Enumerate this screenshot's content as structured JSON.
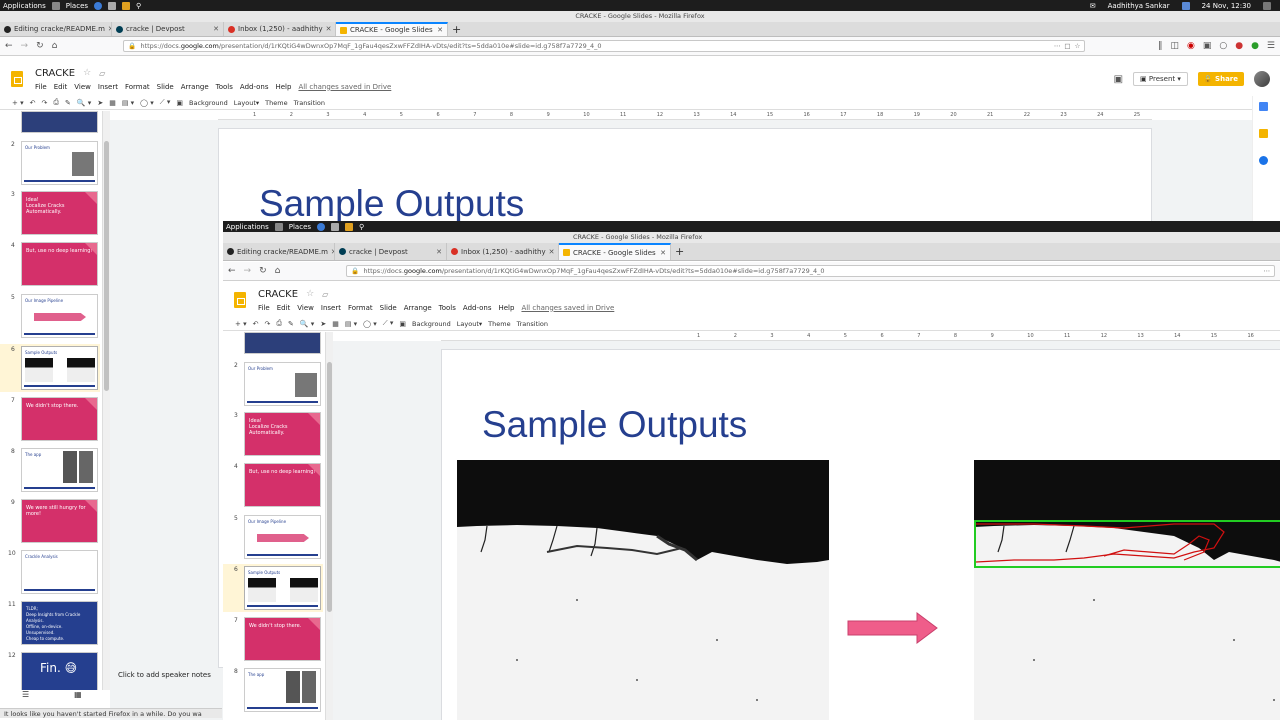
{
  "system": {
    "apps_label": "Applications",
    "places_label": "Places",
    "user_name": "Aadhithya Sankar",
    "datetime": "24 Nov, 12:30"
  },
  "window_title": "CRACKE - Google Slides - Mozilla Firefox",
  "tabs": [
    {
      "label": "Editing cracke/README.m"
    },
    {
      "label": "cracke | Devpost"
    },
    {
      "label": "Inbox (1,250) - aadhithy"
    },
    {
      "label": "CRACKE - Google Slides"
    }
  ],
  "url": {
    "prefix": "https://docs.",
    "domain": "google.com",
    "path": "/presentation/d/1rKQtiG4wDwnxOp7MqF_1gFau4qesZxwFFZdIHA-vDts/edit?ts=5dda010e#slide=id.g758f7a7729_4_0"
  },
  "doc": {
    "title": "CRACKE",
    "menu": [
      "File",
      "Edit",
      "View",
      "Insert",
      "Format",
      "Slide",
      "Arrange",
      "Tools",
      "Add-ons",
      "Help"
    ],
    "saved_status": "All changes saved in Drive",
    "present_label": "Present",
    "share_label": "Share"
  },
  "toolbar": {
    "background": "Background",
    "layout": "Layout",
    "theme": "Theme",
    "transition": "Transition"
  },
  "ruler_ticks": [
    "1",
    "2",
    "3",
    "4",
    "5",
    "6",
    "7",
    "8",
    "9",
    "10",
    "11",
    "12",
    "13",
    "14",
    "15",
    "16",
    "17",
    "18",
    "19",
    "20",
    "21",
    "22",
    "23",
    "24",
    "25"
  ],
  "slides": [
    {
      "num": "2",
      "kind": "white",
      "text": "Our Problem"
    },
    {
      "num": "3",
      "kind": "pink",
      "text": "Idea!\nLocalize Cracks Automatically."
    },
    {
      "num": "4",
      "kind": "pink",
      "text": "But, use no deep learning!"
    },
    {
      "num": "5",
      "kind": "white",
      "text": "Our Image Pipeline"
    },
    {
      "num": "6",
      "kind": "white",
      "text": "Sample Outputs"
    },
    {
      "num": "7",
      "kind": "pink",
      "text": "We didn't stop there."
    },
    {
      "num": "8",
      "kind": "white",
      "text": "The app"
    },
    {
      "num": "9",
      "kind": "pink",
      "text": "We were still hungry for more!"
    },
    {
      "num": "10",
      "kind": "white",
      "text": "Crackle Analysis"
    },
    {
      "num": "11",
      "kind": "blue",
      "text": "TLDR;\nDeep Insights from Crackle Analysis.\nOffline, on-device.\nUnsupervised.\nCheap to compute."
    },
    {
      "num": "12",
      "kind": "blue",
      "text": "Fin. 😅"
    }
  ],
  "slide_title": "Sample Outputs",
  "speaker_notes": "Click to add speaker notes",
  "status_bar": "It looks like you haven't started Firefox in a while. Do you wa",
  "colors": {
    "accent_yellow": "#f4b400",
    "slide_title_blue": "#253f8f",
    "pink": "#d4306a",
    "arrow_pink": "#ef5d8a",
    "green_box": "#22cc22",
    "red_contour": "#d01010"
  }
}
